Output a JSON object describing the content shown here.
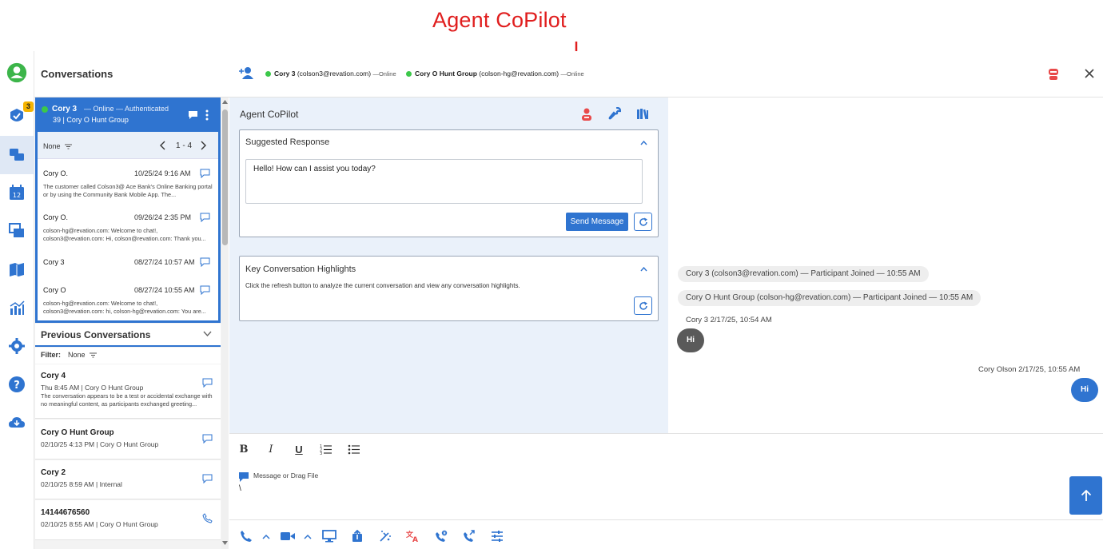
{
  "annotation": {
    "title": "Agent CoPilot"
  },
  "rail": {
    "tasks_badge": "3"
  },
  "conversations": {
    "title": "Conversations",
    "active": {
      "name": "Cory 3",
      "status": "— Online — Authenticated",
      "subtitle": "39 | Cory O Hunt Group",
      "filter": "None",
      "pager": "1 - 4",
      "messages": [
        {
          "name": "Cory O.",
          "date": "10/25/24 9:16 AM",
          "preview": "The customer called Colson3@ Ace Bank's Online Banking portal or by using the Community Bank Mobile App. The..."
        },
        {
          "name": "Cory O.",
          "date": "09/26/24 2:35 PM",
          "preview": "colson-hg@revation.com: Welcome to chat!, colson3@revation.com: Hi, colson@revation.com: Thank you..."
        },
        {
          "name": "Cory 3",
          "date": "08/27/24 10:57 AM",
          "preview": ""
        },
        {
          "name": "Cory O",
          "date": "08/27/24 10:55 AM",
          "preview": "colson-hg@revation.com: Welcome to chat!, colson3@revation.com: hi, colson-hg@revation.com: You are..."
        }
      ]
    },
    "previous": {
      "title": "Previous Conversations",
      "filter_label": "Filter:",
      "filter_value": "None",
      "items": [
        {
          "name": "Cory 4",
          "meta": "Thu 8:45 AM  |  Cory O Hunt Group",
          "summary": "The conversation appears to be a test or accidental exchange with no meaningful content, as participants exchanged greeting..."
        },
        {
          "name": "Cory O Hunt Group",
          "meta": "02/10/25 4:13 PM  |  Cory O Hunt Group",
          "summary": ""
        },
        {
          "name": "Cory 2",
          "meta": "02/10/25 8:59 AM  |  Internal",
          "summary": ""
        },
        {
          "name": "14144676560",
          "meta": "02/10/25 8:55 AM  |  Cory O Hunt Group",
          "summary": ""
        }
      ]
    }
  },
  "topbar": {
    "participants": [
      {
        "name": "Cory 3",
        "email": "(colson3@revation.com)",
        "status": "—Online"
      },
      {
        "name": "Cory O Hunt Group",
        "email": "(colson-hg@revation.com)",
        "status": "—Online"
      }
    ]
  },
  "copilot": {
    "title": "Agent CoPilot",
    "suggested": {
      "title": "Suggested Response",
      "text": "Hello! How can I assist you today?",
      "send_label": "Send Message"
    },
    "highlights": {
      "title": "Key Conversation Highlights",
      "description": "Click the refresh button to analyze the current conversation and view any conversation highlights."
    }
  },
  "chat": {
    "system": [
      "Cory 3 (colson3@revation.com) — Participant Joined — 10:55 AM",
      "Cory O Hunt Group (colson-hg@revation.com) — Participant Joined — 10:55 AM"
    ],
    "incoming": {
      "meta": "Cory 3  2/17/25, 10:54 AM",
      "text": "Hi"
    },
    "outgoing": {
      "meta": "Cory Olson  2/17/25, 10:55 AM",
      "text": "Hi"
    }
  },
  "composer": {
    "placeholder": "Message or Drag File",
    "value": "\\"
  },
  "colors": {
    "accent": "#2f74d0",
    "annotation": "#e01e1e",
    "online": "#3cc84a",
    "panel": "#eaf1fa"
  }
}
